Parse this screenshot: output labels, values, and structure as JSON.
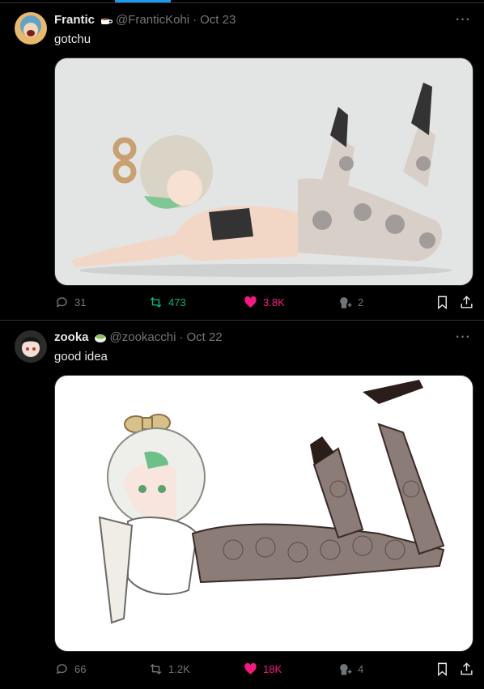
{
  "tweets": [
    {
      "name": "Frantic",
      "handle": "@FranticKohi",
      "separator": "·",
      "date": "Oct 23",
      "text": "gotchu",
      "stats": {
        "replies": "31",
        "retweets": "473",
        "likes": "3.8K",
        "views": "2"
      },
      "accent": {
        "retweet": "#00ba7c",
        "like": "#f91880"
      }
    },
    {
      "name": "zooka",
      "handle": "@zookacchi",
      "separator": "·",
      "date": "Oct 22",
      "text": "good idea",
      "stats": {
        "replies": "66",
        "retweets": "1.2K",
        "likes": "18K",
        "views": "4"
      },
      "accent": {
        "retweet": "#71767b",
        "like": "#f91880"
      }
    }
  ]
}
